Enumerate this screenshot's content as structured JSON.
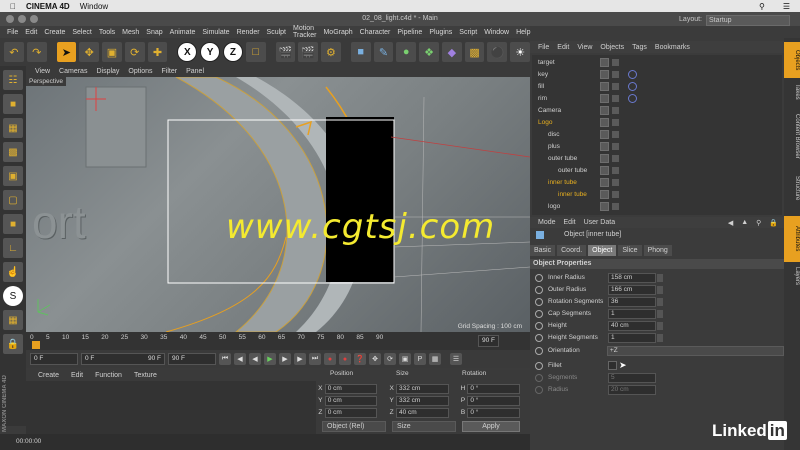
{
  "mac_menubar": {
    "apple": "",
    "app": "CINEMA 4D",
    "window": "Window"
  },
  "title": "02_08_light.c4d * - Main",
  "layout": {
    "label": "Layout:",
    "value": "Startup"
  },
  "app_menu": [
    "File",
    "Edit",
    "Create",
    "Select",
    "Tools",
    "Mesh",
    "Snap",
    "Animate",
    "Simulate",
    "Render",
    "Sculpt",
    "Motion Tracker",
    "MoGraph",
    "Character",
    "Pipeline",
    "Plugins",
    "Script",
    "Window",
    "Help"
  ],
  "toolbar": {
    "x": "X",
    "y": "Y",
    "z": "Z"
  },
  "viewport": {
    "menu": [
      "View",
      "Cameras",
      "Display",
      "Options",
      "Filter",
      "Panel"
    ],
    "camera_label": "Perspective",
    "grid_spacing": "Grid Spacing : 100 cm",
    "text_fragment": "ort",
    "watermark": "www.cgtsj.com"
  },
  "timeline": {
    "ticks": [
      "0",
      "5",
      "10",
      "15",
      "20",
      "25",
      "30",
      "35",
      "40",
      "45",
      "50",
      "55",
      "60",
      "65",
      "70",
      "75",
      "80",
      "85",
      "90"
    ],
    "end_frame": "90 F",
    "start": "0 F",
    "min": "0 F",
    "max": "90 F",
    "max2": "90 F"
  },
  "material_menu": [
    "Create",
    "Edit",
    "Function",
    "Texture"
  ],
  "coords": {
    "headers": [
      "Position",
      "Size",
      "Rotation"
    ],
    "rows": [
      {
        "axis": "X",
        "pos": "0 cm",
        "size_axis": "X",
        "size": "332 cm",
        "rot_axis": "H",
        "rot": "0 °"
      },
      {
        "axis": "Y",
        "pos": "0 cm",
        "size_axis": "Y",
        "size": "332 cm",
        "rot_axis": "P",
        "rot": "0 °"
      },
      {
        "axis": "Z",
        "pos": "0 cm",
        "size_axis": "Z",
        "size": "40 cm",
        "rot_axis": "B",
        "rot": "0 °"
      }
    ],
    "mode": "Object (Rel)",
    "size_mode": "Size",
    "apply": "Apply"
  },
  "status": "00:00:00",
  "maxon": "MAXON CINEMA 4D",
  "objects_menu": [
    "File",
    "Edit",
    "View",
    "Objects",
    "Tags",
    "Bookmarks"
  ],
  "objects": [
    {
      "name": "target",
      "indent": 0
    },
    {
      "name": "key",
      "indent": 0
    },
    {
      "name": "fill",
      "indent": 0
    },
    {
      "name": "rim",
      "indent": 0
    },
    {
      "name": "Camera",
      "indent": 0
    },
    {
      "name": "Logo",
      "indent": 0
    },
    {
      "name": "disc",
      "indent": 1
    },
    {
      "name": "plus",
      "indent": 1
    },
    {
      "name": "outer tube",
      "indent": 1
    },
    {
      "name": "outer tube",
      "indent": 2
    },
    {
      "name": "inner tube",
      "indent": 1
    },
    {
      "name": "inner tube",
      "indent": 2
    },
    {
      "name": "logo",
      "indent": 1
    }
  ],
  "attr_menu": [
    "Mode",
    "Edit",
    "User Data"
  ],
  "attr_object": "Object [inner tube]",
  "attr_tabs": [
    "Basic",
    "Coord.",
    "Object",
    "Slice",
    "Phong"
  ],
  "object_properties": "Object Properties",
  "props": [
    {
      "label": "Inner Radius",
      "value": "158 cm"
    },
    {
      "label": "Outer Radius",
      "value": "166 cm"
    },
    {
      "label": "Rotation Segments",
      "value": "36"
    },
    {
      "label": "Cap Segments",
      "value": "1"
    },
    {
      "label": "Height",
      "value": "40 cm"
    },
    {
      "label": "Height Segments",
      "value": "1"
    }
  ],
  "orientation": {
    "label": "Orientation",
    "value": "+Z"
  },
  "fillet": {
    "label": "Fillet",
    "segments_label": "Segments",
    "segments": "5",
    "radius_label": "Radius",
    "radius": "20 cm"
  },
  "vertical_tabs": [
    "Objects",
    "Takes",
    "Content Browser",
    "Structure",
    "Attributes",
    "Layers"
  ],
  "brand": {
    "a": "Linked",
    "b": "in"
  },
  "colors": {
    "accent": "#e8a020",
    "selected": "#e8b020",
    "blue": "#7ab0e0"
  }
}
